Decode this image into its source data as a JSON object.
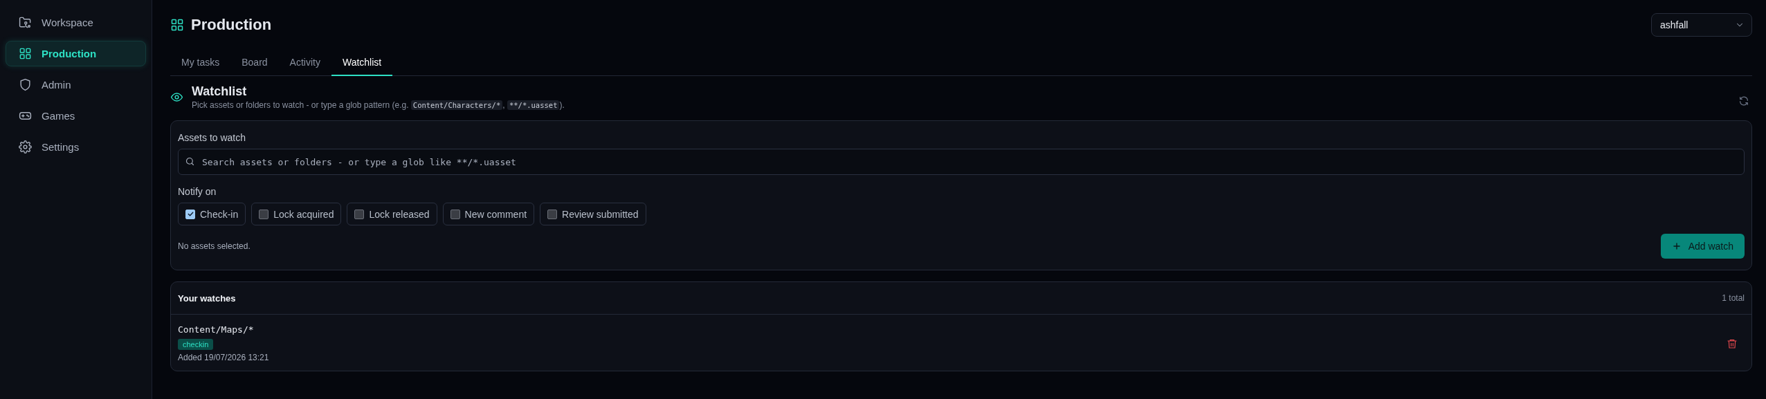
{
  "sidebar": {
    "items": [
      {
        "label": "Workspace",
        "selected": false
      },
      {
        "label": "Production",
        "selected": true
      },
      {
        "label": "Admin",
        "selected": false
      },
      {
        "label": "Games",
        "selected": false
      },
      {
        "label": "Settings",
        "selected": false
      }
    ]
  },
  "header": {
    "title": "Production",
    "project_select": {
      "value": "ashfall"
    }
  },
  "tabs": [
    {
      "label": "My tasks",
      "selected": false
    },
    {
      "label": "Board",
      "selected": false
    },
    {
      "label": "Activity",
      "selected": false
    },
    {
      "label": "Watchlist",
      "selected": true
    }
  ],
  "section": {
    "title": "Watchlist",
    "description": [
      {
        "kind": "text",
        "text": "Pick assets or folders to watch - or type a glob pattern (e.g. "
      },
      {
        "kind": "code",
        "text": "Content/Characters/*"
      },
      {
        "kind": "text",
        "text": ", "
      },
      {
        "kind": "code",
        "text": "**/*.uasset"
      },
      {
        "kind": "text",
        "text": ")."
      }
    ]
  },
  "form": {
    "assets_label": "Assets to watch",
    "search": {
      "placeholder": "Search assets or folders - or type a glob like **/*.uasset"
    },
    "notify_label": "Notify on",
    "events": [
      {
        "label": "Check-in",
        "checked": true
      },
      {
        "label": "Lock acquired",
        "checked": false
      },
      {
        "label": "Lock released",
        "checked": false
      },
      {
        "label": "New comment",
        "checked": false
      },
      {
        "label": "Review submitted",
        "checked": false
      }
    ],
    "status": "No assets selected.",
    "add_button": "Add watch"
  },
  "watches": {
    "title": "Your watches",
    "count": "1 total",
    "items": [
      {
        "path": "Content/Maps/*",
        "tags": [
          "checkin"
        ],
        "added": "Added 19/07/2026 13:21"
      }
    ]
  }
}
